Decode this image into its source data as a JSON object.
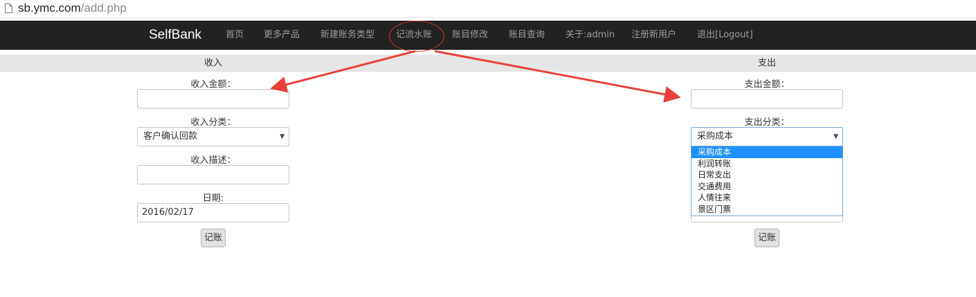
{
  "browser": {
    "url_host": "sb.ymc.com",
    "url_path": "/add.php"
  },
  "navbar": {
    "brand": "SelfBank",
    "items": [
      {
        "label": "首页"
      },
      {
        "label": "更多产品"
      },
      {
        "label": "新建账务类型"
      },
      {
        "label": "记流水账"
      },
      {
        "label": "账目修改"
      },
      {
        "label": "账目查询"
      },
      {
        "label": "关于:admin"
      },
      {
        "label": "注册新用户"
      },
      {
        "label": "退出[Logout]"
      }
    ]
  },
  "income": {
    "title": "收入",
    "amount_label": "收入金额：",
    "amount_value": "",
    "category_label": "收入分类：",
    "category_value": "客户确认回款",
    "desc_label": "收入描述：",
    "desc_value": "",
    "date_label": "日期:",
    "date_value": "2016/02/17",
    "submit_label": "记账"
  },
  "expense": {
    "title": "支出",
    "amount_label": "支出金额：",
    "amount_value": "",
    "category_label": "支出分类：",
    "category_value": "采购成本",
    "category_options": [
      "采购成本",
      "利润转账",
      "日常支出",
      "交通费用",
      "人情往来",
      "景区门票"
    ],
    "selected_option": 0,
    "submit_label": "记账"
  },
  "colors": {
    "navbar_bg": "#222222",
    "nav_text": "#9d9d9d",
    "annotation": "#e8423a",
    "dropdown_selected": "#1e90ff"
  }
}
